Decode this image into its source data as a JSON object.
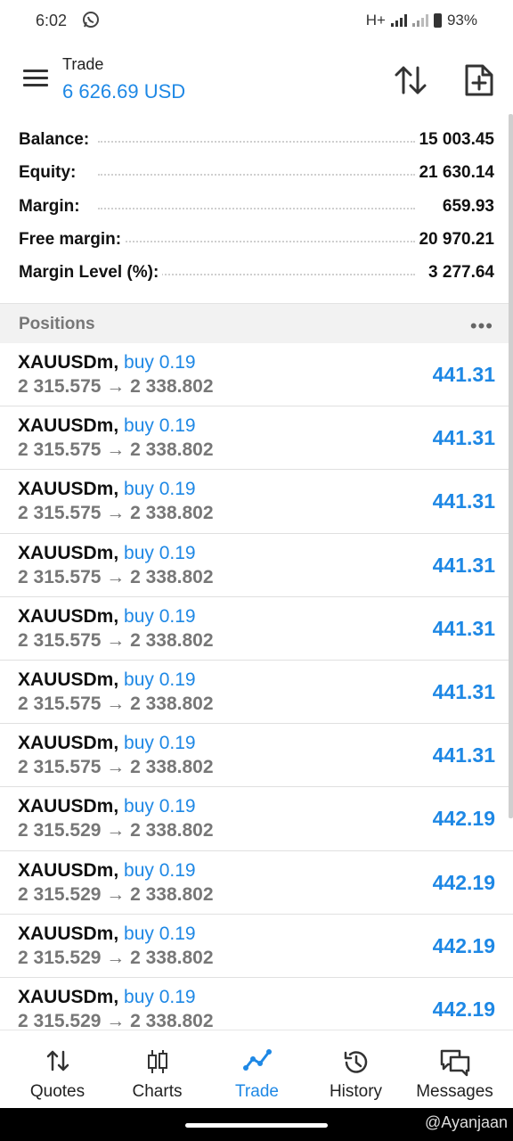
{
  "status_bar": {
    "time": "6:02",
    "network": "H+",
    "battery": "93%"
  },
  "app_bar": {
    "title": "Trade",
    "subtitle": "6 626.69 USD"
  },
  "summary": [
    {
      "label": "Balance:",
      "value": "15 003.45"
    },
    {
      "label": "Equity:",
      "value": "21 630.14"
    },
    {
      "label": "Margin:",
      "value": "659.93"
    },
    {
      "label": "Free margin:",
      "value": "20 970.21"
    },
    {
      "label": "Margin Level (%):",
      "value": "3 277.64"
    }
  ],
  "positions_header": {
    "label": "Positions"
  },
  "positions": [
    {
      "symbol": "XAUUSDm,",
      "side": "buy 0.19",
      "prices": "2 315.575 → 2 338.802",
      "profit": "441.31"
    },
    {
      "symbol": "XAUUSDm,",
      "side": "buy 0.19",
      "prices": "2 315.575 → 2 338.802",
      "profit": "441.31"
    },
    {
      "symbol": "XAUUSDm,",
      "side": "buy 0.19",
      "prices": "2 315.575 → 2 338.802",
      "profit": "441.31"
    },
    {
      "symbol": "XAUUSDm,",
      "side": "buy 0.19",
      "prices": "2 315.575 → 2 338.802",
      "profit": "441.31"
    },
    {
      "symbol": "XAUUSDm,",
      "side": "buy 0.19",
      "prices": "2 315.575 → 2 338.802",
      "profit": "441.31"
    },
    {
      "symbol": "XAUUSDm,",
      "side": "buy 0.19",
      "prices": "2 315.575 → 2 338.802",
      "profit": "441.31"
    },
    {
      "symbol": "XAUUSDm,",
      "side": "buy 0.19",
      "prices": "2 315.575 → 2 338.802",
      "profit": "441.31"
    },
    {
      "symbol": "XAUUSDm,",
      "side": "buy 0.19",
      "prices": "2 315.529 → 2 338.802",
      "profit": "442.19"
    },
    {
      "symbol": "XAUUSDm,",
      "side": "buy 0.19",
      "prices": "2 315.529 → 2 338.802",
      "profit": "442.19"
    },
    {
      "symbol": "XAUUSDm,",
      "side": "buy 0.19",
      "prices": "2 315.529 → 2 338.802",
      "profit": "442.19"
    },
    {
      "symbol": "XAUUSDm,",
      "side": "buy 0.19",
      "prices": "2 315.529 → 2 338.802",
      "profit": "442.19"
    }
  ],
  "bottom_nav": [
    {
      "label": "Quotes",
      "icon": "quotes-icon"
    },
    {
      "label": "Charts",
      "icon": "charts-icon"
    },
    {
      "label": "Trade",
      "icon": "trade-icon",
      "active": true
    },
    {
      "label": "History",
      "icon": "history-icon"
    },
    {
      "label": "Messages",
      "icon": "messages-icon"
    }
  ],
  "watermark": "@Ayanjaan",
  "colors": {
    "accent": "#1e88e5",
    "text": "#111111",
    "muted": "#777777"
  }
}
